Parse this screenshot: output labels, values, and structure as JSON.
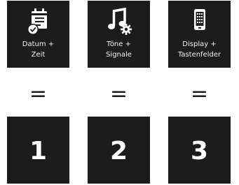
{
  "menu_tiles": [
    {
      "icon": "calendar-clock-icon",
      "label": "Datum +\nZeit"
    },
    {
      "icon": "music-note-gear-icon",
      "label": "Töne +\nSignale"
    },
    {
      "icon": "phone-keypad-icon",
      "label": "Display +\nTastenfelder"
    }
  ],
  "equals": [
    "=",
    "=",
    "="
  ],
  "number_keys": [
    "1",
    "2",
    "3"
  ],
  "colors": {
    "tile_background": "#1c1c1c",
    "text": "#ffffff",
    "equals_sign": "#1c1c1c"
  }
}
